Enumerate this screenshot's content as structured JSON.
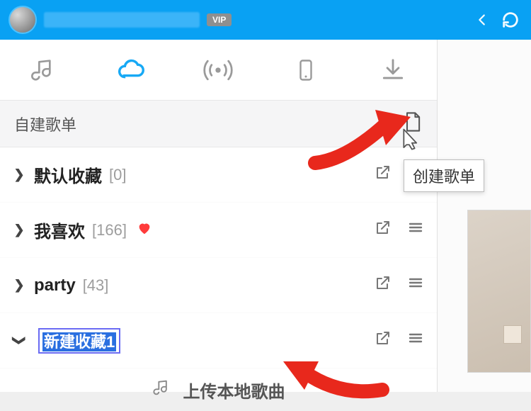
{
  "titlebar": {
    "vip_label": "VIP"
  },
  "section": {
    "title": "自建歌单",
    "tooltip": "创建歌单"
  },
  "playlists": [
    {
      "name": "默认收藏",
      "count": "[0]",
      "heart": false,
      "expanded": false,
      "editing": false
    },
    {
      "name": "我喜欢",
      "count": "[166]",
      "heart": true,
      "expanded": false,
      "editing": false
    },
    {
      "name": "party",
      "count": "[43]",
      "heart": false,
      "expanded": false,
      "editing": false
    },
    {
      "name": "新建收藏1",
      "count": "",
      "heart": false,
      "expanded": true,
      "editing": true
    }
  ],
  "upload": {
    "label": "上传本地歌曲"
  }
}
